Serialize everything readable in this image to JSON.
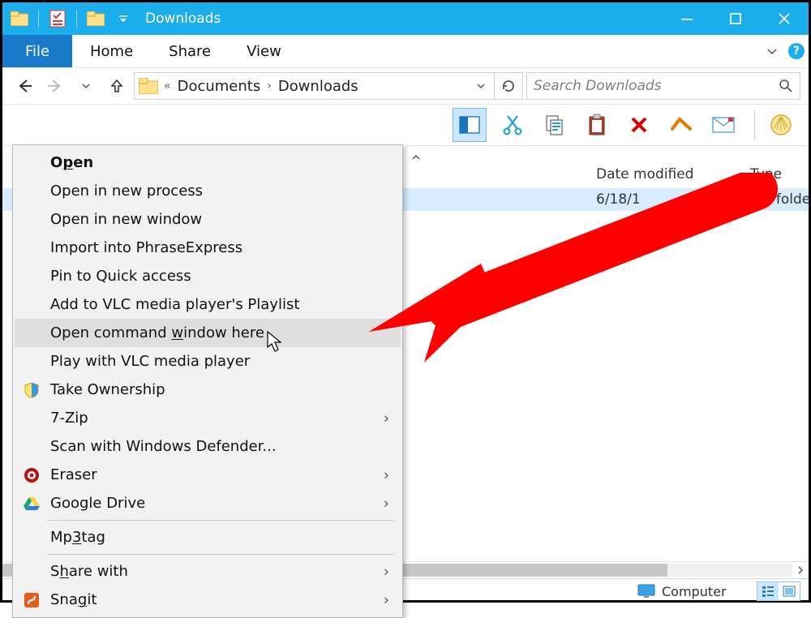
{
  "window": {
    "title": "Downloads"
  },
  "tabs": {
    "file": "File",
    "home": "Home",
    "share": "Share",
    "view": "View"
  },
  "address": {
    "seg1": "Documents",
    "seg2": "Downloads"
  },
  "search": {
    "placeholder": "Search Downloads"
  },
  "columns": {
    "date_modified": "Date modified",
    "type": "Type"
  },
  "rows": [
    {
      "date": "6/18/1",
      "type": "File folde"
    }
  ],
  "status": {
    "location": "Computer"
  },
  "context_menu": {
    "open_pre": "O",
    "open_u": "p",
    "open_post": "en",
    "open_new_process": "Open in new process",
    "open_new_window": "Open in new window",
    "import_phrase": "Import into PhraseExpress",
    "pin_quick": "Pin to Quick access",
    "add_vlc": "Add to VLC media player's Playlist",
    "cmd_pre": "Open command ",
    "cmd_u": "w",
    "cmd_post": "indow here",
    "play_vlc": "Play with VLC media player",
    "take_ownership": "Take Ownership",
    "seven_zip": "7-Zip",
    "scan_defender": "Scan with Windows Defender...",
    "eraser": "Eraser",
    "gdrive": "Google Drive",
    "mp3tag_pre": "Mp",
    "mp3tag_u": "3",
    "mp3tag_post": "tag",
    "share_pre": "S",
    "share_u": "h",
    "share_post": "are with",
    "snagit_pre": "Sna",
    "snagit_u": "g",
    "snagit_post": "it"
  }
}
